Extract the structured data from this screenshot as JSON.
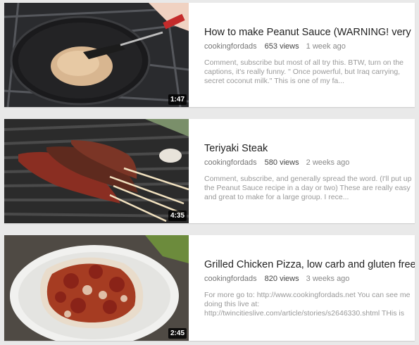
{
  "colors": {
    "page_bg": "#e9e9e9",
    "card_bg": "#ffffff",
    "title": "#222222",
    "meta": "#777777",
    "desc": "#999999"
  },
  "videos": [
    {
      "title": "How to make Peanut Sauce (WARNING! very",
      "channel": "cookingfordads",
      "views": "653 views",
      "age": "1 week ago",
      "description": "Comment, subscribe but most of all try this. BTW, turn on the captions, it's really funny. \" Once powerful, but Iraq carrying, secret coconut milk.\" This is one of my fa...",
      "duration": "1:47",
      "thumbnail": "pan-with-peanut-sauce"
    },
    {
      "title": "Teriyaki Steak",
      "channel": "cookingfordads",
      "views": "580 views",
      "age": "2 weeks ago",
      "description": "Comment, subscribe, and generally spread the word. (I'll put up the Peanut Sauce recipe in a day or two) These are really easy and great to make for a large group. I rece...",
      "duration": "4:35",
      "thumbnail": "steak-skewers-on-grill"
    },
    {
      "title": "Grilled Chicken Pizza, low carb and gluten free",
      "channel": "cookingfordads",
      "views": "820 views",
      "age": "3 weeks ago",
      "description": "For more go to: http://www.cookingfordads.net You can see me doing this live at: http://twincitieslive.com/article/stories/s2646330.shtml THis is",
      "duration": "2:45",
      "thumbnail": "chicken-pizza-on-plate"
    }
  ]
}
